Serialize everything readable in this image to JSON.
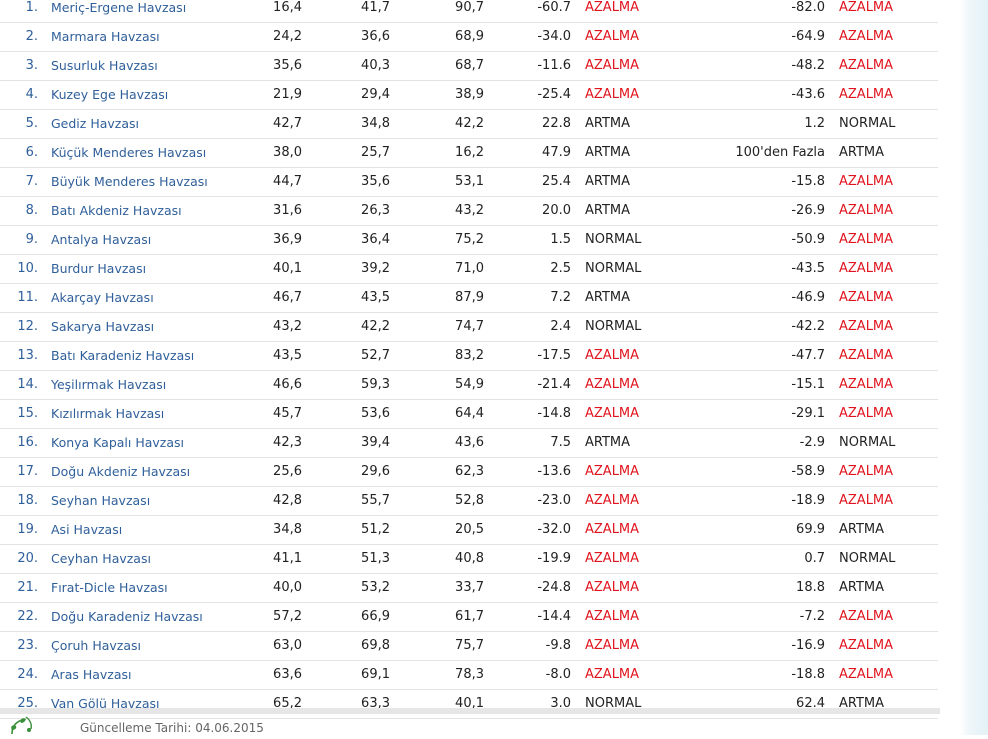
{
  "table": {
    "rows": [
      {
        "idx": "1.",
        "name": "Meriç-Ergene Havzası",
        "v1": "16,4",
        "v2": "41,7",
        "v3": "90,7",
        "d1": "-60.7",
        "s1": "AZALMA",
        "d2": "-82.0",
        "s2": "AZALMA"
      },
      {
        "idx": "2.",
        "name": "Marmara Havzası",
        "v1": "24,2",
        "v2": "36,6",
        "v3": "68,9",
        "d1": "-34.0",
        "s1": "AZALMA",
        "d2": "-64.9",
        "s2": "AZALMA"
      },
      {
        "idx": "3.",
        "name": "Susurluk Havzası",
        "v1": "35,6",
        "v2": "40,3",
        "v3": "68,7",
        "d1": "-11.6",
        "s1": "AZALMA",
        "d2": "-48.2",
        "s2": "AZALMA"
      },
      {
        "idx": "4.",
        "name": "Kuzey Ege Havzası",
        "v1": "21,9",
        "v2": "29,4",
        "v3": "38,9",
        "d1": "-25.4",
        "s1": "AZALMA",
        "d2": "-43.6",
        "s2": "AZALMA"
      },
      {
        "idx": "5.",
        "name": "Gediz Havzası",
        "v1": "42,7",
        "v2": "34,8",
        "v3": "42,2",
        "d1": "22.8",
        "s1": "ARTMA",
        "d2": "1.2",
        "s2": "NORMAL"
      },
      {
        "idx": "6.",
        "name": "Küçük Menderes Havzası",
        "v1": "38,0",
        "v2": "25,7",
        "v3": "16,2",
        "d1": "47.9",
        "s1": "ARTMA",
        "d2": "100'den Fazla",
        "s2": "ARTMA"
      },
      {
        "idx": "7.",
        "name": "Büyük Menderes Havzası",
        "v1": "44,7",
        "v2": "35,6",
        "v3": "53,1",
        "d1": "25.4",
        "s1": "ARTMA",
        "d2": "-15.8",
        "s2": "AZALMA"
      },
      {
        "idx": "8.",
        "name": "Batı Akdeniz Havzası",
        "v1": "31,6",
        "v2": "26,3",
        "v3": "43,2",
        "d1": "20.0",
        "s1": "ARTMA",
        "d2": "-26.9",
        "s2": "AZALMA"
      },
      {
        "idx": "9.",
        "name": "Antalya Havzası",
        "v1": "36,9",
        "v2": "36,4",
        "v3": "75,2",
        "d1": "1.5",
        "s1": "NORMAL",
        "d2": "-50.9",
        "s2": "AZALMA"
      },
      {
        "idx": "10.",
        "name": "Burdur Havzası",
        "v1": "40,1",
        "v2": "39,2",
        "v3": "71,0",
        "d1": "2.5",
        "s1": "NORMAL",
        "d2": "-43.5",
        "s2": "AZALMA"
      },
      {
        "idx": "11.",
        "name": "Akarçay Havzası",
        "v1": "46,7",
        "v2": "43,5",
        "v3": "87,9",
        "d1": "7.2",
        "s1": "ARTMA",
        "d2": "-46.9",
        "s2": "AZALMA"
      },
      {
        "idx": "12.",
        "name": "Sakarya Havzası",
        "v1": "43,2",
        "v2": "42,2",
        "v3": "74,7",
        "d1": "2.4",
        "s1": "NORMAL",
        "d2": "-42.2",
        "s2": "AZALMA"
      },
      {
        "idx": "13.",
        "name": "Batı Karadeniz Havzası",
        "v1": "43,5",
        "v2": "52,7",
        "v3": "83,2",
        "d1": "-17.5",
        "s1": "AZALMA",
        "d2": "-47.7",
        "s2": "AZALMA"
      },
      {
        "idx": "14.",
        "name": "Yeşilırmak Havzası",
        "v1": "46,6",
        "v2": "59,3",
        "v3": "54,9",
        "d1": "-21.4",
        "s1": "AZALMA",
        "d2": "-15.1",
        "s2": "AZALMA"
      },
      {
        "idx": "15.",
        "name": "Kızılırmak Havzası",
        "v1": "45,7",
        "v2": "53,6",
        "v3": "64,4",
        "d1": "-14.8",
        "s1": "AZALMA",
        "d2": "-29.1",
        "s2": "AZALMA"
      },
      {
        "idx": "16.",
        "name": "Konya Kapalı Havzası",
        "v1": "42,3",
        "v2": "39,4",
        "v3": "43,6",
        "d1": "7.5",
        "s1": "ARTMA",
        "d2": "-2.9",
        "s2": "NORMAL"
      },
      {
        "idx": "17.",
        "name": "Doğu Akdeniz Havzası",
        "v1": "25,6",
        "v2": "29,6",
        "v3": "62,3",
        "d1": "-13.6",
        "s1": "AZALMA",
        "d2": "-58.9",
        "s2": "AZALMA"
      },
      {
        "idx": "18.",
        "name": "Seyhan Havzası",
        "v1": "42,8",
        "v2": "55,7",
        "v3": "52,8",
        "d1": "-23.0",
        "s1": "AZALMA",
        "d2": "-18.9",
        "s2": "AZALMA"
      },
      {
        "idx": "19.",
        "name": "Asi Havzası",
        "v1": "34,8",
        "v2": "51,2",
        "v3": "20,5",
        "d1": "-32.0",
        "s1": "AZALMA",
        "d2": "69.9",
        "s2": "ARTMA"
      },
      {
        "idx": "20.",
        "name": "Ceyhan Havzası",
        "v1": "41,1",
        "v2": "51,3",
        "v3": "40,8",
        "d1": "-19.9",
        "s1": "AZALMA",
        "d2": "0.7",
        "s2": "NORMAL"
      },
      {
        "idx": "21.",
        "name": "Fırat-Dicle Havzası",
        "v1": "40,0",
        "v2": "53,2",
        "v3": "33,7",
        "d1": "-24.8",
        "s1": "AZALMA",
        "d2": "18.8",
        "s2": "ARTMA"
      },
      {
        "idx": "22.",
        "name": "Doğu Karadeniz Havzası",
        "v1": "57,2",
        "v2": "66,9",
        "v3": "61,7",
        "d1": "-14.4",
        "s1": "AZALMA",
        "d2": "-7.2",
        "s2": "AZALMA"
      },
      {
        "idx": "23.",
        "name": "Çoruh Havzası",
        "v1": "63,0",
        "v2": "69,8",
        "v3": "75,7",
        "d1": "-9.8",
        "s1": "AZALMA",
        "d2": "-16.9",
        "s2": "AZALMA"
      },
      {
        "idx": "24.",
        "name": "Aras Havzası",
        "v1": "63,6",
        "v2": "69,1",
        "v3": "78,3",
        "d1": "-8.0",
        "s1": "AZALMA",
        "d2": "-18.8",
        "s2": "AZALMA"
      },
      {
        "idx": "25.",
        "name": "Van Gölü Havzası",
        "v1": "65,2",
        "v2": "63,3",
        "v3": "40,1",
        "d1": "3.0",
        "s1": "NORMAL",
        "d2": "62.4",
        "s2": "ARTMA"
      }
    ]
  },
  "footer": {
    "update_label": "Güncelleme Tarihi: 04.06.2015",
    "logo_icon": "leaf-logo-icon"
  },
  "colors": {
    "link": "#2f5f9a",
    "decrease": "#e0141e",
    "text": "#222222",
    "row_border": "#e3e3e3"
  }
}
